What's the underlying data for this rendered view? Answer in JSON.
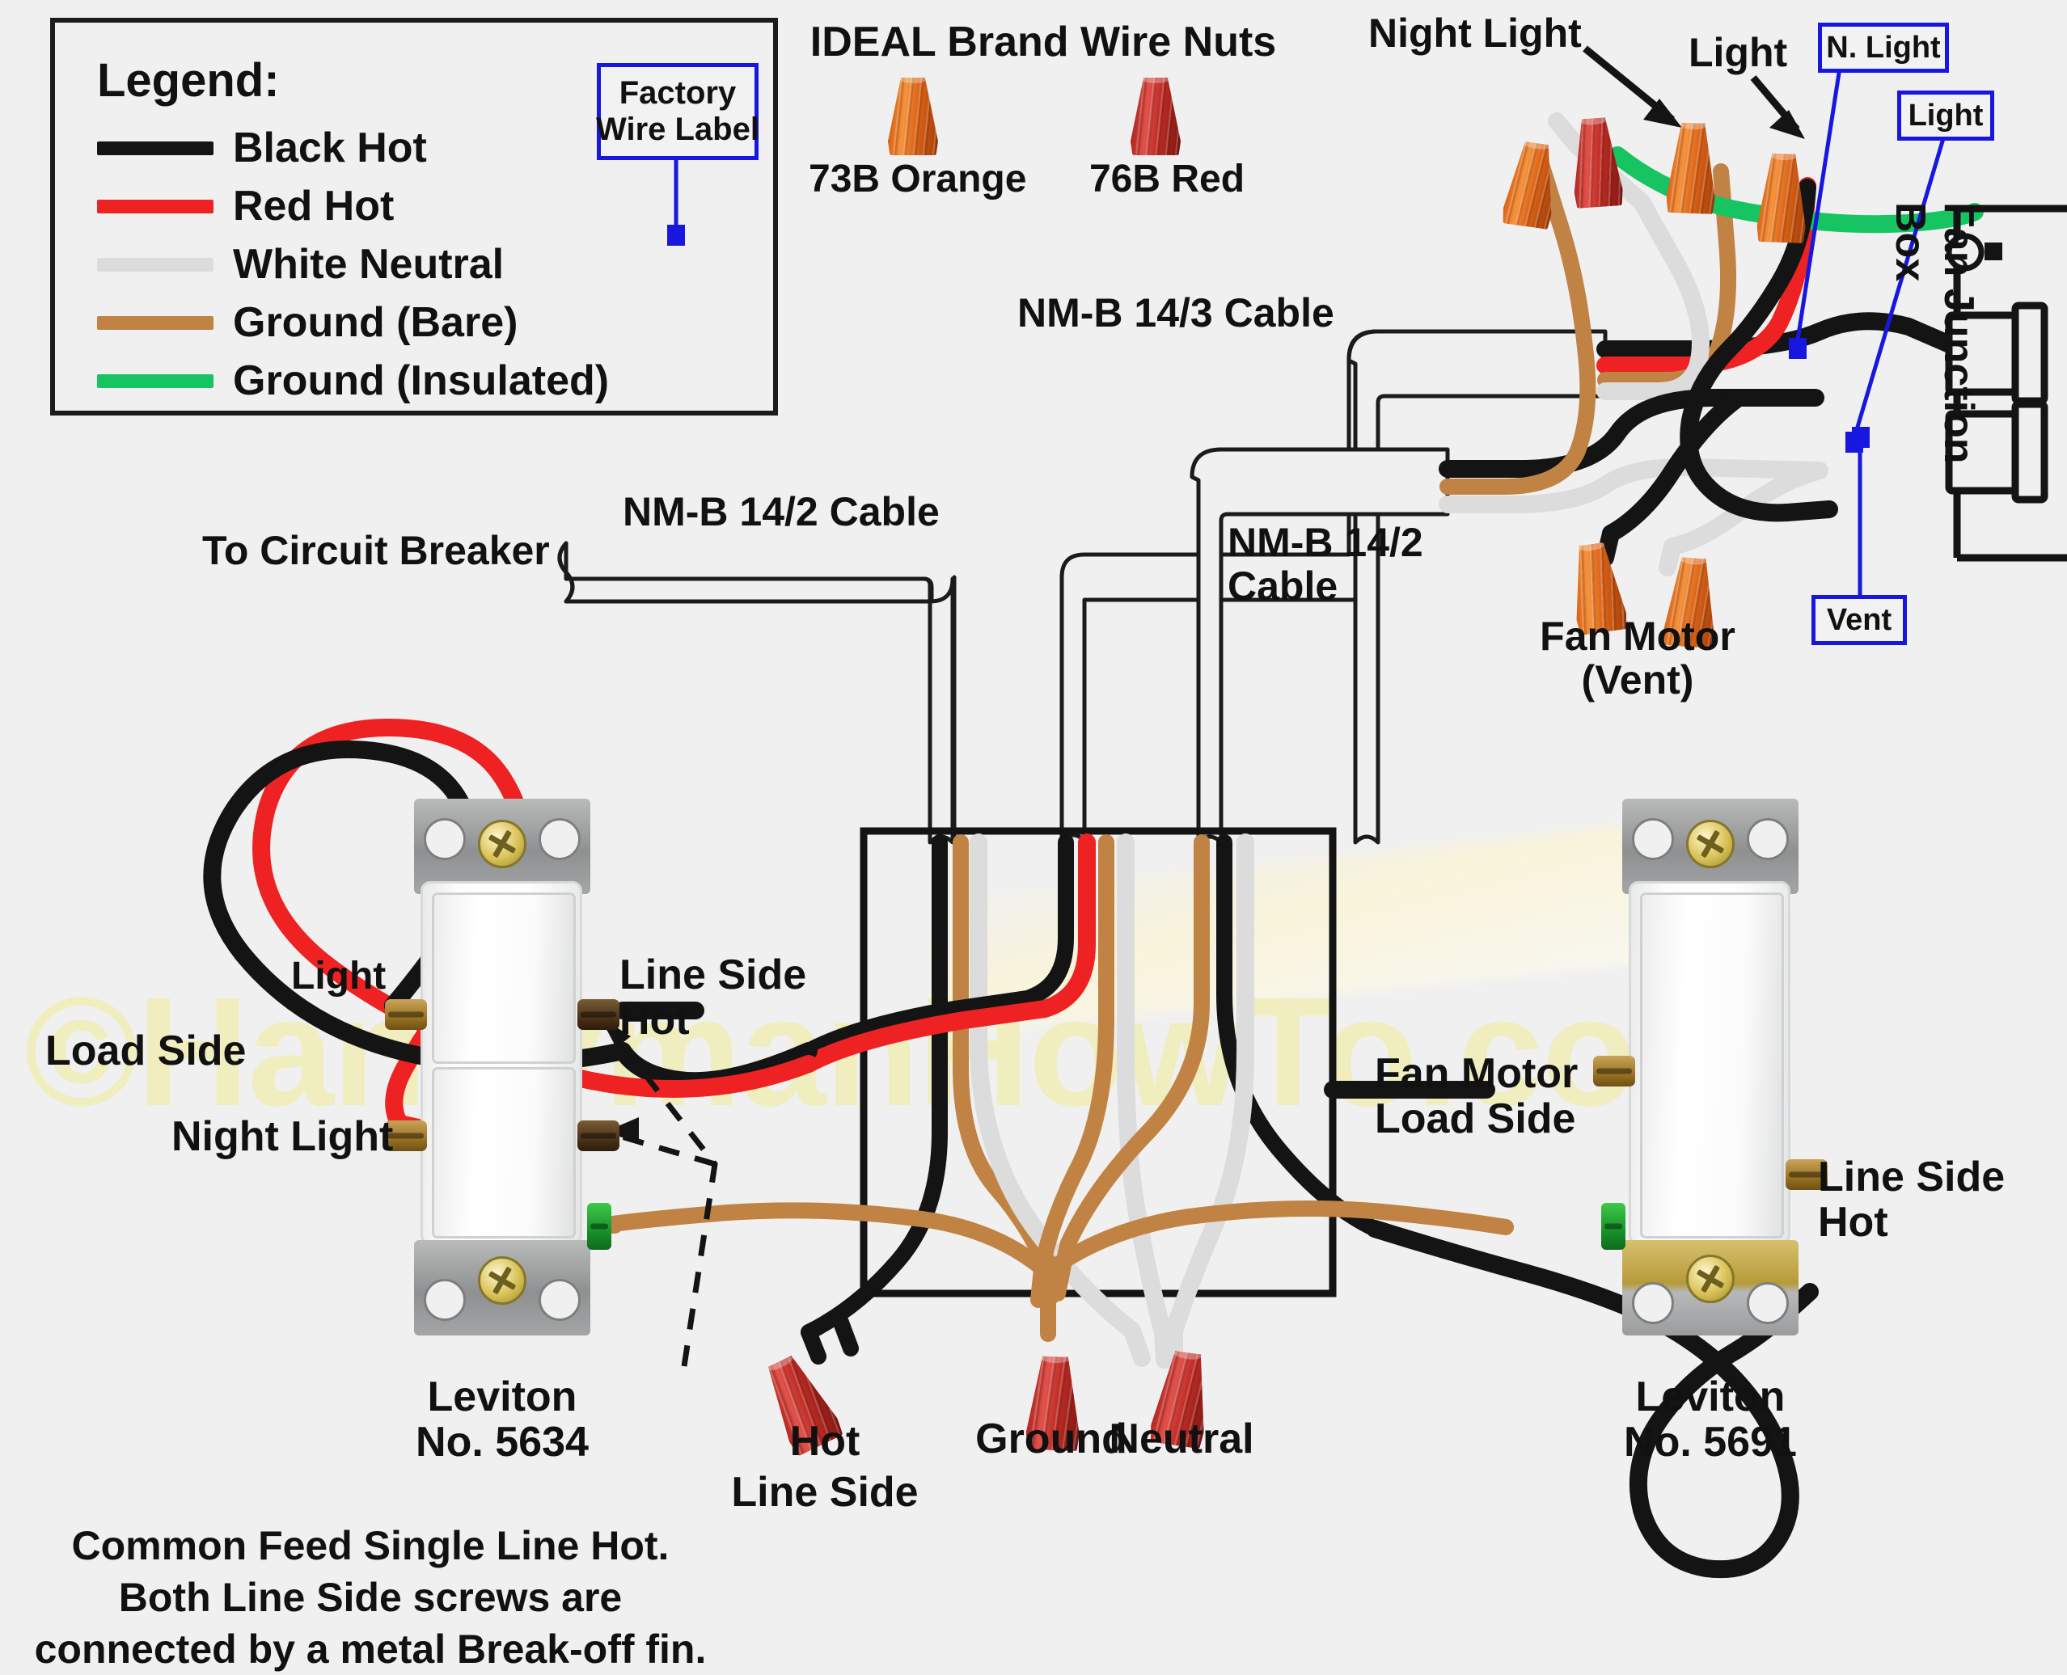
{
  "colors": {
    "background": "#f0f0f0",
    "black_hot": "#141414",
    "red_hot": "#ee2222",
    "white_neutral": "#dcdcdc",
    "ground_bare": "#c08344",
    "ground_insulated": "#16c462",
    "callout_blue": "#1717e0",
    "nut_orange": "#e5711f",
    "nut_red": "#c0302a",
    "watermark": "#f0edbf"
  },
  "legend": {
    "title": "Legend:",
    "items": [
      {
        "label": "Black Hot",
        "color": "#141414"
      },
      {
        "label": "Red Hot",
        "color": "#ee2222"
      },
      {
        "label": "White Neutral",
        "color": "#dcdcdc"
      },
      {
        "label": "Ground (Bare)",
        "color": "#c08344"
      },
      {
        "label": "Ground (Insulated)",
        "color": "#16c462"
      }
    ],
    "factory_wire_label": "Factory\nWire Label"
  },
  "wire_nuts_panel": {
    "title": "IDEAL Brand Wire Nuts",
    "items": [
      {
        "label": "73B Orange",
        "color": "#e5711f"
      },
      {
        "label": "76B Red",
        "color": "#c0302a"
      }
    ]
  },
  "callouts": {
    "night_light": "Night Light",
    "light": "Light",
    "n_light_tag": "N. Light",
    "light_tag": "Light",
    "vent_tag": "Vent",
    "fan_junction_box": "Fan Junction Box",
    "fan_motor_vent": "Fan Motor\n(Vent)"
  },
  "cables": {
    "nmb_14_3": "NM-B 14/3 Cable",
    "nmb_14_2_right": "NM-B 14/2\nCable",
    "nmb_14_2_left": "NM-B 14/2 Cable",
    "to_circuit_breaker": "To Circuit Breaker"
  },
  "left_switch": {
    "model": "Leviton\nNo. 5634",
    "terminals": {
      "light": "Light",
      "night_light": "Night Light",
      "load_side": "Load Side",
      "line_side_hot": "Line Side\nHot"
    },
    "note": "Common Feed Single Line Hot.\nBoth Line Side screws are\nconnected by a metal Break-off fin."
  },
  "right_switch": {
    "model": "Leviton\nNo. 5691",
    "terminals": {
      "fan_motor_load_side": "Fan Motor\nLoad Side",
      "line_side_hot": "Line Side\nHot"
    }
  },
  "switch_box_nuts": [
    {
      "label": "Hot\nLine Side",
      "color": "#c0302a"
    },
    {
      "label": "Ground",
      "color": "#c0302a"
    },
    {
      "label": "Neutral",
      "color": "#c0302a"
    }
  ],
  "watermark": {
    "text": "©HandymanHowTo.com"
  }
}
